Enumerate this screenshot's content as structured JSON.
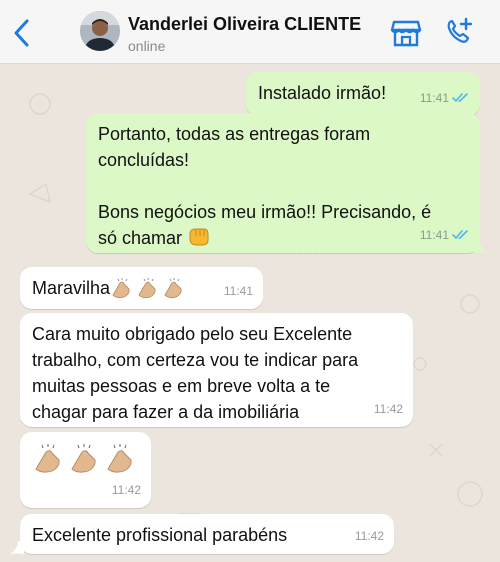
{
  "header": {
    "contact_name": "Vanderlei Oliveira CLIENTE",
    "status": "online"
  },
  "messages": [
    {
      "direction": "out",
      "text": "Instalado irmão!",
      "time": "11:41",
      "read": true
    },
    {
      "direction": "out",
      "text_line1": "Portanto, todas as entregas foram",
      "text_line2": "concluídas!",
      "text_line3": "Bons negócios meu irmão!! Precisando, é",
      "text_line4": "só chamar",
      "emoji": "oncoming-fist",
      "time": "11:41",
      "read": true
    },
    {
      "direction": "in",
      "text": "Maravilha",
      "emoji": "clapping-hands x3",
      "time": "11:41"
    },
    {
      "direction": "in",
      "line1": "Cara muito obrigado pelo seu Excelente",
      "line2": "trabalho, com certeza vou te indicar para",
      "line3": "muitas pessoas e em breve volta a te",
      "line4": "chagar para fazer a da imobiliária",
      "time": "11:42"
    },
    {
      "direction": "in",
      "emoji": "clapping-hands x3",
      "time": "11:42"
    },
    {
      "direction": "in",
      "text": "Excelente profissional parabéns",
      "time": "11:42"
    }
  ],
  "colors": {
    "outgoing": "#dcf8c6",
    "incoming": "#ffffff",
    "accent": "#1f7ae0",
    "read_ticks": "#4fb6ec"
  }
}
